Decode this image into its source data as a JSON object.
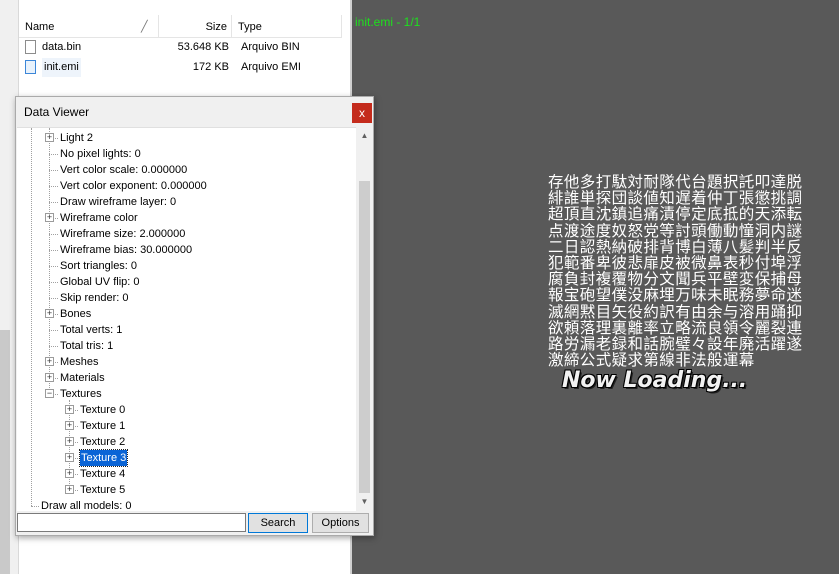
{
  "file_list": {
    "columns": {
      "name": "Name",
      "size": "Size",
      "type": "Type"
    },
    "files": [
      {
        "name": "data.bin",
        "size": "53.648 KB",
        "type": "Arquivo BIN",
        "icon": "file-icon"
      },
      {
        "name": "init.emi",
        "size": "172 KB",
        "type": "Arquivo EMI",
        "icon": "emi-file-icon"
      }
    ]
  },
  "preview": {
    "title": "init.emi - 1/1",
    "text_lines": [
      "存他多打駄対耐隊代台題択託叩達脱",
      "緋誰単探団談値知遅着仲丁張懲挑調",
      "超頂直沈鎮追痛漬停定底抵的天添転",
      "点渡途度奴怒党等討頭働動憧洞内謎",
      "二日認熱納破排背博白薄八髪判半反",
      "犯範番卑彼悲扉皮被微鼻表秒付埠浮",
      "腐負封複覆物分文聞兵平壁変保捕母",
      "報宝砲望僕没麻埋万味未眠務夢命迷",
      "滅網黙目矢役約訳有由余与溶用踊抑",
      "欲頼落理裏離率立略流良領令麗裂連",
      "路労漏老録和話腕璧々設年廃活躍遂",
      "激締公式疑求第線非法般運幕"
    ],
    "loading_text": "Now Loading...",
    "title_color": "#1ee01e",
    "background_color": "#595959"
  },
  "dialog": {
    "title": "Data Viewer",
    "close_label": "x",
    "tree_items": [
      {
        "label": "Light 2",
        "expander": "+",
        "level": 1,
        "selected": false
      },
      {
        "label": "No pixel lights: 0",
        "expander": "",
        "level": 1,
        "selected": false
      },
      {
        "label": "Vert color scale: 0.000000",
        "expander": "",
        "level": 1,
        "selected": false
      },
      {
        "label": "Vert color exponent: 0.000000",
        "expander": "",
        "level": 1,
        "selected": false
      },
      {
        "label": "Draw wireframe layer: 0",
        "expander": "",
        "level": 1,
        "selected": false
      },
      {
        "label": "Wireframe color",
        "expander": "+",
        "level": 1,
        "selected": false
      },
      {
        "label": "Wireframe size: 2.000000",
        "expander": "",
        "level": 1,
        "selected": false
      },
      {
        "label": "Wireframe bias: 30.000000",
        "expander": "",
        "level": 1,
        "selected": false
      },
      {
        "label": "Sort triangles: 0",
        "expander": "",
        "level": 1,
        "selected": false
      },
      {
        "label": "Global UV flip: 0",
        "expander": "",
        "level": 1,
        "selected": false
      },
      {
        "label": "Skip render: 0",
        "expander": "",
        "level": 1,
        "selected": false
      },
      {
        "label": "Bones",
        "expander": "+",
        "level": 1,
        "selected": false
      },
      {
        "label": "Total verts: 1",
        "expander": "",
        "level": 1,
        "selected": false
      },
      {
        "label": "Total tris: 1",
        "expander": "",
        "level": 1,
        "selected": false
      },
      {
        "label": "Meshes",
        "expander": "+",
        "level": 1,
        "selected": false
      },
      {
        "label": "Materials",
        "expander": "+",
        "level": 1,
        "selected": false
      },
      {
        "label": "Textures",
        "expander": "-",
        "level": 1,
        "selected": false
      },
      {
        "label": "Texture 0",
        "expander": "+",
        "level": 2,
        "selected": false
      },
      {
        "label": "Texture 1",
        "expander": "+",
        "level": 2,
        "selected": false
      },
      {
        "label": "Texture 2",
        "expander": "+",
        "level": 2,
        "selected": false
      },
      {
        "label": "Texture 3",
        "expander": "+",
        "level": 2,
        "selected": true
      },
      {
        "label": "Texture 4",
        "expander": "+",
        "level": 2,
        "selected": false
      },
      {
        "label": "Texture 5",
        "expander": "+",
        "level": 2,
        "selected": false
      },
      {
        "label": "Draw all models: 0",
        "expander": "",
        "level": 0,
        "selected": false
      }
    ],
    "search_value": "",
    "search_label": "Search",
    "options_label": "Options",
    "selection_color": "#0a64d6",
    "close_color": "#c42b1c"
  }
}
